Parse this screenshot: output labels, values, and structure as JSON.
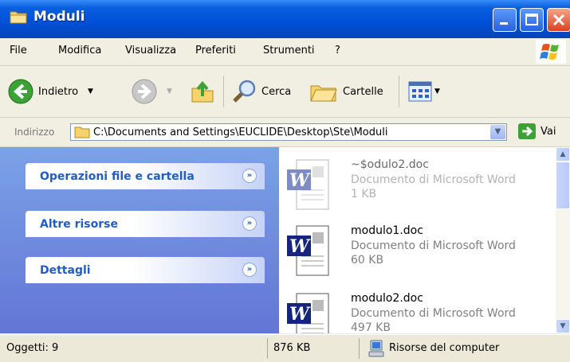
{
  "window": {
    "title": "Moduli"
  },
  "menu": {
    "items": [
      "File",
      "Modifica",
      "Visualizza",
      "Preferiti",
      "Strumenti",
      "?"
    ]
  },
  "toolbar": {
    "back_label": "Indietro",
    "search_label": "Cerca",
    "folders_label": "Cartelle"
  },
  "address": {
    "label": "Indirizzo",
    "path": "C:\\Documents and Settings\\EUCLIDE\\Desktop\\Ste\\Moduli",
    "go_label": "Vai"
  },
  "tasks": {
    "panels": [
      "Operazioni file e cartella",
      "Altre risorse",
      "Dettagli"
    ]
  },
  "files": [
    {
      "name": "~$odulo2.doc",
      "type": "Documento di Microsoft Word",
      "size": "1 KB"
    },
    {
      "name": "modulo1.doc",
      "type": "Documento di Microsoft Word",
      "size": "60 KB"
    },
    {
      "name": "modulo2.doc",
      "type": "Documento di Microsoft Word",
      "size": "497 KB"
    }
  ],
  "status": {
    "objects": "Oggetti: 9",
    "size": "876 KB",
    "location": "Risorse del computer"
  },
  "colors": {
    "title_blue": "#0050D8",
    "task_pane": "#6F8CDE",
    "panel_text": "#215DC6",
    "close_red": "#D9431C"
  }
}
